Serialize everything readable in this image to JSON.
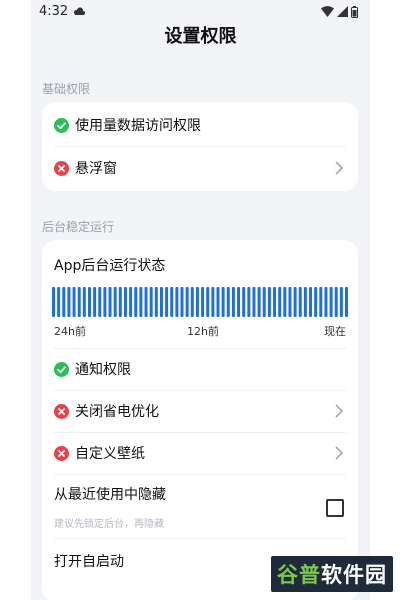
{
  "status_bar": {
    "time": "4:32"
  },
  "page": {
    "title": "设置权限"
  },
  "basic_section": {
    "label": "基础权限",
    "items": [
      {
        "label": "使用量数据访问权限",
        "status": "granted"
      },
      {
        "label": "悬浮窗",
        "status": "denied"
      }
    ]
  },
  "background_section": {
    "label": "后台稳定运行",
    "status_card": {
      "title": "App后台运行状态",
      "bar_color": "#1f6fe0",
      "axis_labels": [
        "24h前",
        "12h前",
        "现在"
      ]
    },
    "items": [
      {
        "label": "通知权限",
        "status": "granted"
      },
      {
        "label": "关闭省电优化",
        "status": "denied"
      },
      {
        "label": "自定义壁纸",
        "status": "denied"
      }
    ],
    "hide_recent": {
      "label": "从最近使用中隐藏",
      "hint": "建议先锁定后台，再隐藏",
      "checked": false
    },
    "autostart": {
      "label": "打开自启动"
    }
  },
  "colors": {
    "granted": "#2bbd5a",
    "denied": "#e8414a",
    "background": "#f3f4f8",
    "text_secondary": "#9aa0aa"
  },
  "watermark": {
    "part1": "谷普",
    "part2": "软件园"
  }
}
